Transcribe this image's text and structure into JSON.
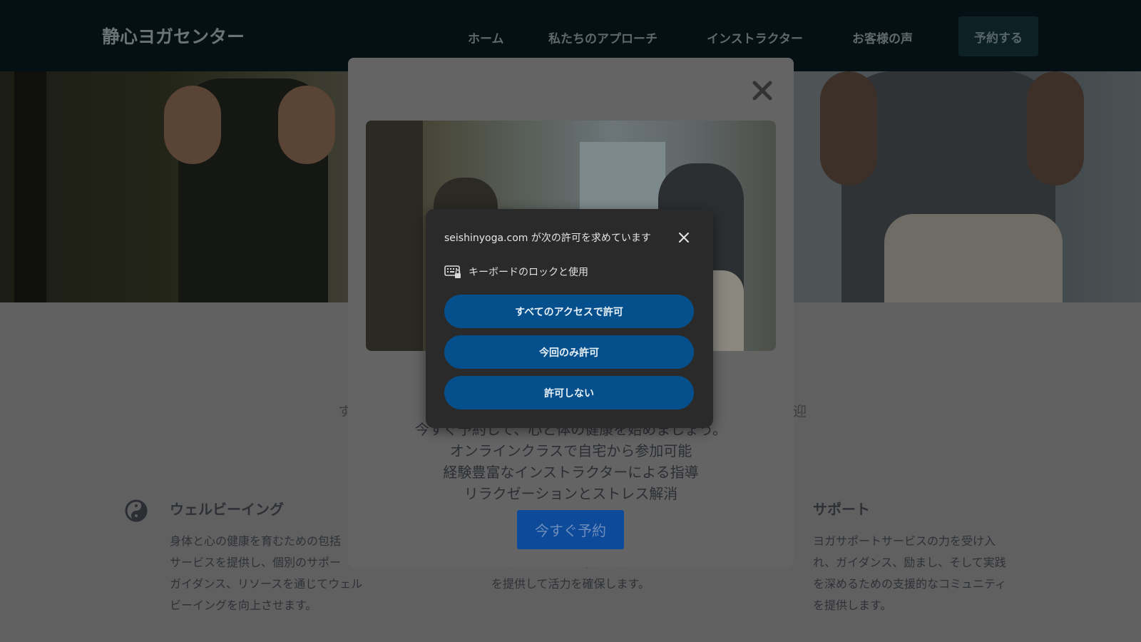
{
  "site": {
    "logo": "静心ヨガセンター",
    "nav": {
      "home": "ホーム",
      "approach": "私たちのアプローチ",
      "instructors": "インストラクター",
      "testimonials": "お客様の声",
      "reserve": "予約する"
    }
  },
  "content": {
    "frag_left": "す",
    "frag_right": "迎",
    "features": [
      {
        "title": "ウェルビーイング",
        "text": "身体と心の健康を育むための包括\nサービスを提供し、個別のサポー\nガイダンス、リソースを通じてウェル\nビーイングを向上させます。"
      },
      {
        "text": "ション、ホリスティックなアプローチ\nを提供して活力を確保します。"
      },
      {
        "title": "サポート",
        "text": "ヨガサポートサービスの力を受け入\nれ、ガイダンス、励まし、そして実践\nを深めるための支援的なコミュニティ\nを提供します。"
      }
    ]
  },
  "modal": {
    "line1": "今すぐ予約して、心と体の健康を始めましょう。",
    "line2": "オンラインクラスで自宅から参加可能",
    "line3": "経験豊富なインストラクターによる指導",
    "line4": "リラクゼーションとストレス解消",
    "book_now": "今すぐ予約"
  },
  "permission": {
    "title": "seishinyoga.com が次の許可を求めています",
    "item_label": "キーボードのロックと使用",
    "item_icon": "keyboard-lock-icon",
    "allow_always": "すべてのアクセスで許可",
    "allow_once": "今回のみ許可",
    "deny": "許可しない"
  },
  "colors": {
    "prompt_bg": "#2a2a2a",
    "prompt_button": "#05508c",
    "header_bg": "#041014",
    "book_button": "#0d4a9a"
  }
}
